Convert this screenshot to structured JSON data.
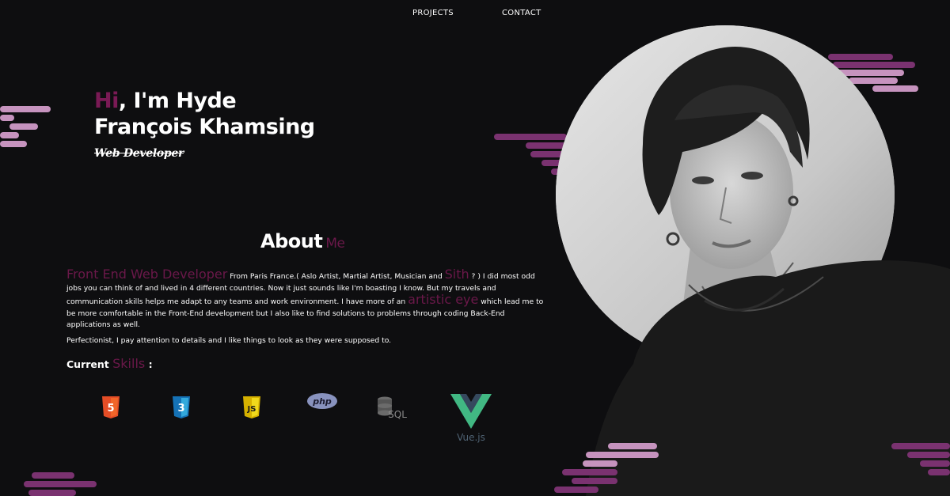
{
  "nav": {
    "projects": "PROJECTS",
    "contact": "CONTACT"
  },
  "hero": {
    "greeting_accent": "Hi",
    "greeting_rest": ", I'm Hyde",
    "name_line2": "François Khamsing",
    "role": "Web Developer"
  },
  "about": {
    "title": "About",
    "title_accent": "Me",
    "p1_accent1": "Front End Web Developer",
    "p1_a": " From Paris France.( Aslo Artist, Martial Artist, Musician and ",
    "p1_accent2": "Sith",
    "p1_b": " ? ) I did most odd jobs you can think of and lived in 4 different countries. Now it just sounds like I'm boasting I know. But my travels and communication skills helps me adapt to any teams and work environment. I have more of an ",
    "p1_accent3": "artistic eye",
    "p1_c": " which lead me to be more comfortable in the Front-End development but I also like to find solutions to problems through coding Back-End applications as well.",
    "p2": "Perfectionist, I pay attention to details and I like things to look as they were supposed to."
  },
  "skills": {
    "label": "Current",
    "label_accent": "Skills",
    "label_end": " :",
    "items": [
      {
        "name": "html5-icon",
        "text": "5"
      },
      {
        "name": "css3-icon",
        "text": "3"
      },
      {
        "name": "js-icon",
        "text": "JS"
      },
      {
        "name": "php-icon",
        "text": "php"
      },
      {
        "name": "sql-icon",
        "text": "SQL"
      },
      {
        "name": "vue-icon",
        "text": "Vue.js"
      }
    ]
  },
  "colors": {
    "background": "#0e0e10",
    "accent": "#6a1849",
    "cloud_purple": "#7a3270",
    "cloud_pink": "#c693be"
  }
}
